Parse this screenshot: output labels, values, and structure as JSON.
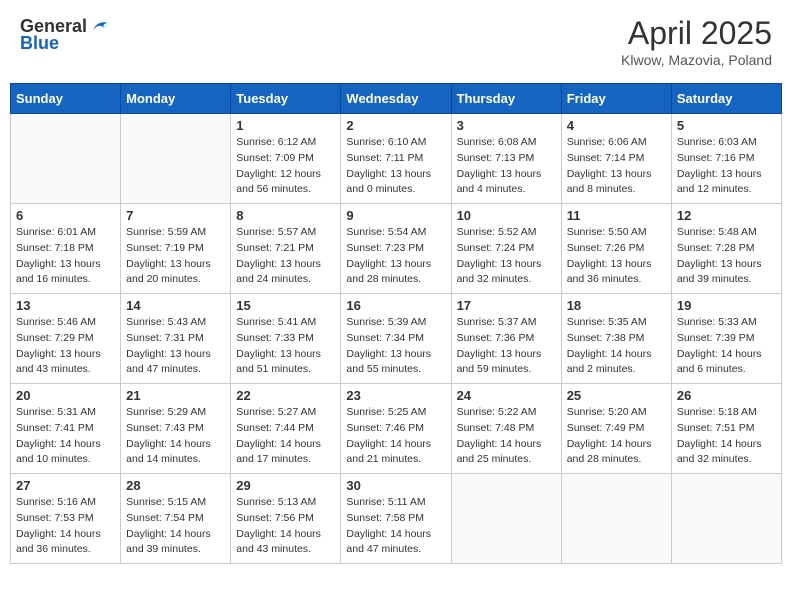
{
  "header": {
    "logo_general": "General",
    "logo_blue": "Blue",
    "month_title": "April 2025",
    "location": "Klwow, Mazovia, Poland"
  },
  "days_of_week": [
    "Sunday",
    "Monday",
    "Tuesday",
    "Wednesday",
    "Thursday",
    "Friday",
    "Saturday"
  ],
  "weeks": [
    [
      {
        "day": "",
        "info": []
      },
      {
        "day": "",
        "info": []
      },
      {
        "day": "1",
        "info": [
          "Sunrise: 6:12 AM",
          "Sunset: 7:09 PM",
          "Daylight: 12 hours",
          "and 56 minutes."
        ]
      },
      {
        "day": "2",
        "info": [
          "Sunrise: 6:10 AM",
          "Sunset: 7:11 PM",
          "Daylight: 13 hours",
          "and 0 minutes."
        ]
      },
      {
        "day": "3",
        "info": [
          "Sunrise: 6:08 AM",
          "Sunset: 7:13 PM",
          "Daylight: 13 hours",
          "and 4 minutes."
        ]
      },
      {
        "day": "4",
        "info": [
          "Sunrise: 6:06 AM",
          "Sunset: 7:14 PM",
          "Daylight: 13 hours",
          "and 8 minutes."
        ]
      },
      {
        "day": "5",
        "info": [
          "Sunrise: 6:03 AM",
          "Sunset: 7:16 PM",
          "Daylight: 13 hours",
          "and 12 minutes."
        ]
      }
    ],
    [
      {
        "day": "6",
        "info": [
          "Sunrise: 6:01 AM",
          "Sunset: 7:18 PM",
          "Daylight: 13 hours",
          "and 16 minutes."
        ]
      },
      {
        "day": "7",
        "info": [
          "Sunrise: 5:59 AM",
          "Sunset: 7:19 PM",
          "Daylight: 13 hours",
          "and 20 minutes."
        ]
      },
      {
        "day": "8",
        "info": [
          "Sunrise: 5:57 AM",
          "Sunset: 7:21 PM",
          "Daylight: 13 hours",
          "and 24 minutes."
        ]
      },
      {
        "day": "9",
        "info": [
          "Sunrise: 5:54 AM",
          "Sunset: 7:23 PM",
          "Daylight: 13 hours",
          "and 28 minutes."
        ]
      },
      {
        "day": "10",
        "info": [
          "Sunrise: 5:52 AM",
          "Sunset: 7:24 PM",
          "Daylight: 13 hours",
          "and 32 minutes."
        ]
      },
      {
        "day": "11",
        "info": [
          "Sunrise: 5:50 AM",
          "Sunset: 7:26 PM",
          "Daylight: 13 hours",
          "and 36 minutes."
        ]
      },
      {
        "day": "12",
        "info": [
          "Sunrise: 5:48 AM",
          "Sunset: 7:28 PM",
          "Daylight: 13 hours",
          "and 39 minutes."
        ]
      }
    ],
    [
      {
        "day": "13",
        "info": [
          "Sunrise: 5:46 AM",
          "Sunset: 7:29 PM",
          "Daylight: 13 hours",
          "and 43 minutes."
        ]
      },
      {
        "day": "14",
        "info": [
          "Sunrise: 5:43 AM",
          "Sunset: 7:31 PM",
          "Daylight: 13 hours",
          "and 47 minutes."
        ]
      },
      {
        "day": "15",
        "info": [
          "Sunrise: 5:41 AM",
          "Sunset: 7:33 PM",
          "Daylight: 13 hours",
          "and 51 minutes."
        ]
      },
      {
        "day": "16",
        "info": [
          "Sunrise: 5:39 AM",
          "Sunset: 7:34 PM",
          "Daylight: 13 hours",
          "and 55 minutes."
        ]
      },
      {
        "day": "17",
        "info": [
          "Sunrise: 5:37 AM",
          "Sunset: 7:36 PM",
          "Daylight: 13 hours",
          "and 59 minutes."
        ]
      },
      {
        "day": "18",
        "info": [
          "Sunrise: 5:35 AM",
          "Sunset: 7:38 PM",
          "Daylight: 14 hours",
          "and 2 minutes."
        ]
      },
      {
        "day": "19",
        "info": [
          "Sunrise: 5:33 AM",
          "Sunset: 7:39 PM",
          "Daylight: 14 hours",
          "and 6 minutes."
        ]
      }
    ],
    [
      {
        "day": "20",
        "info": [
          "Sunrise: 5:31 AM",
          "Sunset: 7:41 PM",
          "Daylight: 14 hours",
          "and 10 minutes."
        ]
      },
      {
        "day": "21",
        "info": [
          "Sunrise: 5:29 AM",
          "Sunset: 7:43 PM",
          "Daylight: 14 hours",
          "and 14 minutes."
        ]
      },
      {
        "day": "22",
        "info": [
          "Sunrise: 5:27 AM",
          "Sunset: 7:44 PM",
          "Daylight: 14 hours",
          "and 17 minutes."
        ]
      },
      {
        "day": "23",
        "info": [
          "Sunrise: 5:25 AM",
          "Sunset: 7:46 PM",
          "Daylight: 14 hours",
          "and 21 minutes."
        ]
      },
      {
        "day": "24",
        "info": [
          "Sunrise: 5:22 AM",
          "Sunset: 7:48 PM",
          "Daylight: 14 hours",
          "and 25 minutes."
        ]
      },
      {
        "day": "25",
        "info": [
          "Sunrise: 5:20 AM",
          "Sunset: 7:49 PM",
          "Daylight: 14 hours",
          "and 28 minutes."
        ]
      },
      {
        "day": "26",
        "info": [
          "Sunrise: 5:18 AM",
          "Sunset: 7:51 PM",
          "Daylight: 14 hours",
          "and 32 minutes."
        ]
      }
    ],
    [
      {
        "day": "27",
        "info": [
          "Sunrise: 5:16 AM",
          "Sunset: 7:53 PM",
          "Daylight: 14 hours",
          "and 36 minutes."
        ]
      },
      {
        "day": "28",
        "info": [
          "Sunrise: 5:15 AM",
          "Sunset: 7:54 PM",
          "Daylight: 14 hours",
          "and 39 minutes."
        ]
      },
      {
        "day": "29",
        "info": [
          "Sunrise: 5:13 AM",
          "Sunset: 7:56 PM",
          "Daylight: 14 hours",
          "and 43 minutes."
        ]
      },
      {
        "day": "30",
        "info": [
          "Sunrise: 5:11 AM",
          "Sunset: 7:58 PM",
          "Daylight: 14 hours",
          "and 47 minutes."
        ]
      },
      {
        "day": "",
        "info": []
      },
      {
        "day": "",
        "info": []
      },
      {
        "day": "",
        "info": []
      }
    ]
  ]
}
